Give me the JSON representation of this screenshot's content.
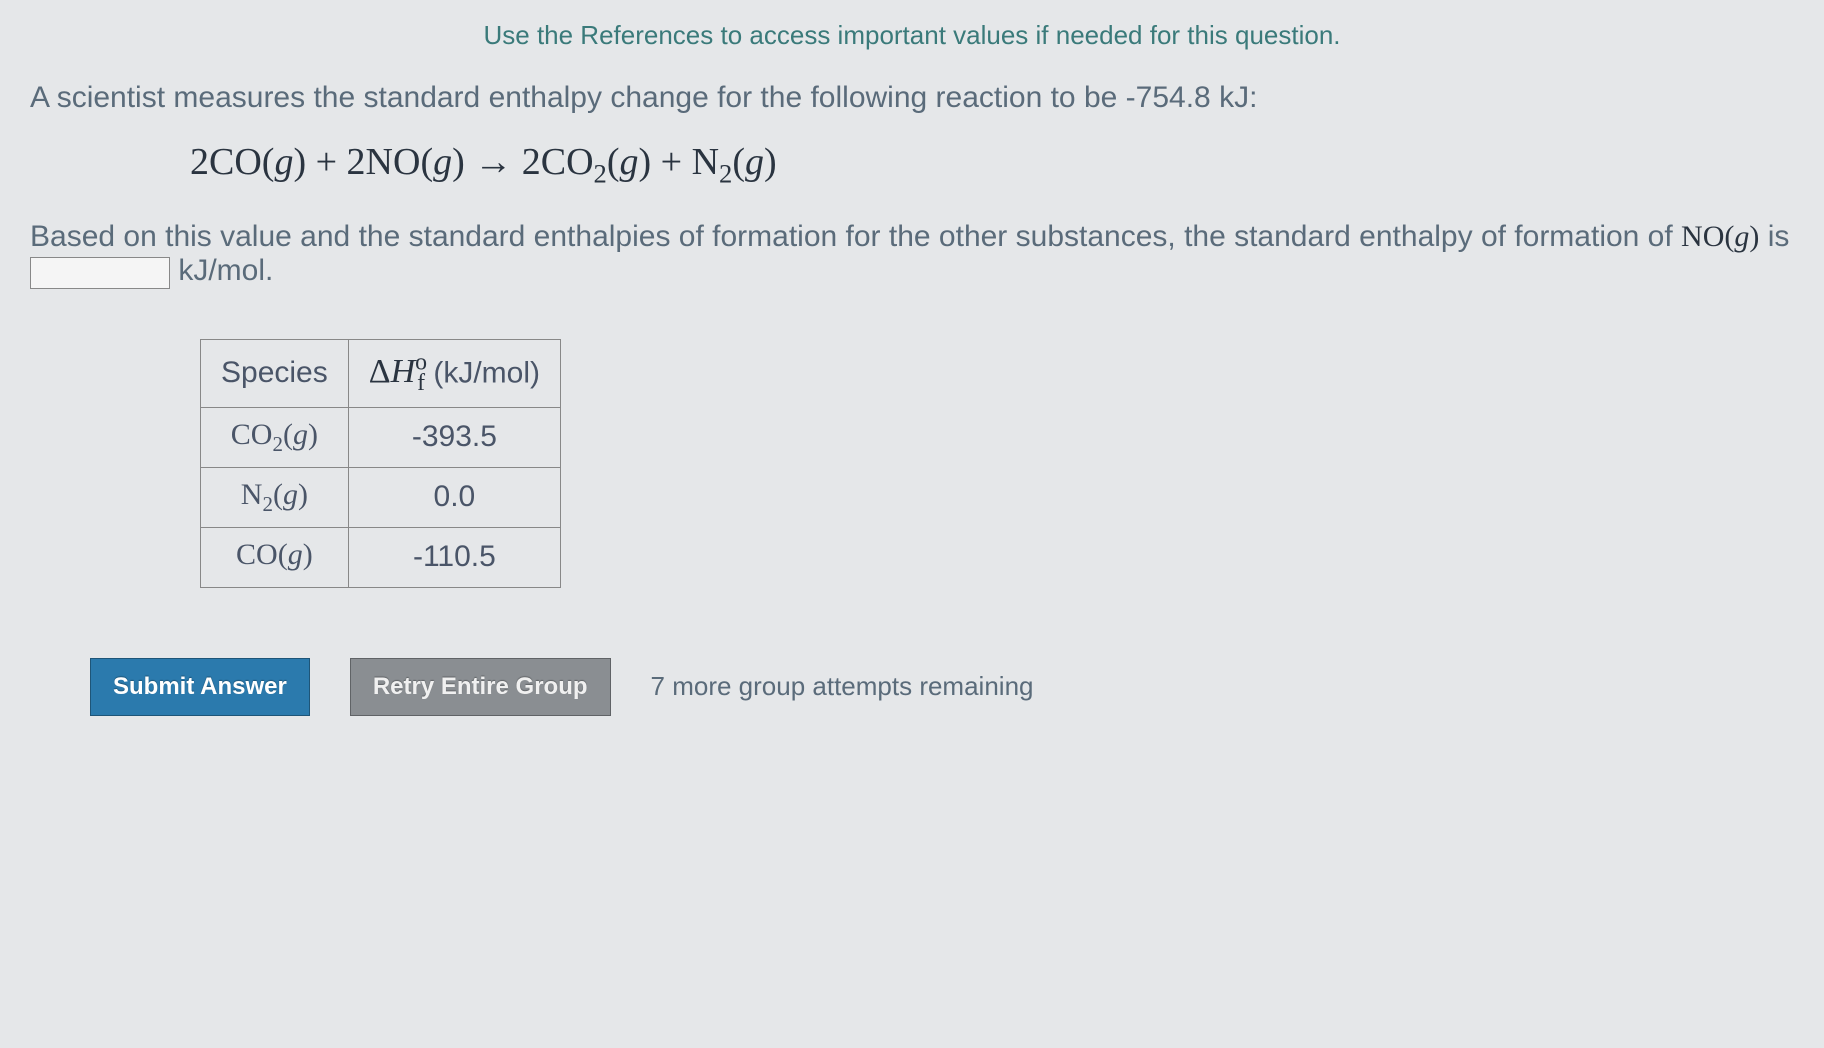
{
  "hint": "Use the References to access important values if needed for this question.",
  "question": {
    "line1_prefix": "A scientist measures the standard enthalpy change for the following reaction to be ",
    "enthalpy_value": "-754.8 kJ",
    "line1_suffix": ":",
    "equation": {
      "reactant1_coef": "2",
      "reactant1": "CO",
      "reactant1_state": "g",
      "plus1": " + ",
      "reactant2_coef": "2",
      "reactant2": "NO",
      "reactant2_state": "g",
      "arrow": " → ",
      "product1_coef": "2",
      "product1": "CO",
      "product1_sub": "2",
      "product1_state": "g",
      "plus2": " + ",
      "product2": "N",
      "product2_sub": "2",
      "product2_state": "g"
    },
    "line2_prefix": "Based on this value and the standard enthalpies of formation for the other substances, the standard enthalpy of formation of ",
    "target_species": "NO",
    "target_state": "g",
    "line2_mid": " is ",
    "unit": " kJ/mol."
  },
  "table": {
    "header_species": "Species",
    "header_value_prefix": "Δ",
    "header_value_H": "H",
    "header_value_sup": "o",
    "header_value_sub": "f",
    "header_value_unit": " (kJ/mol)",
    "rows": [
      {
        "species": "CO",
        "sub": "2",
        "state": "g",
        "value": "-393.5"
      },
      {
        "species": "N",
        "sub": "2",
        "state": "g",
        "value": "0.0"
      },
      {
        "species": "CO",
        "sub": "",
        "state": "g",
        "value": "-110.5"
      }
    ]
  },
  "buttons": {
    "submit": "Submit Answer",
    "retry": "Retry Entire Group"
  },
  "attempts": "7 more group attempts remaining"
}
